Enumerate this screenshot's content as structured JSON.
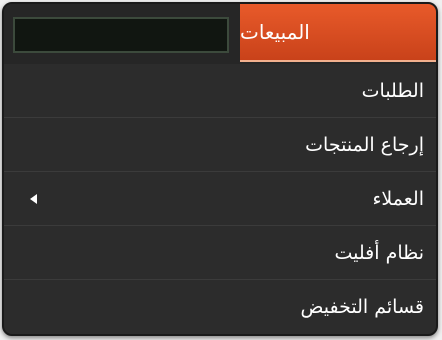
{
  "menu": {
    "active_tab": "المبيعات",
    "search_value": "",
    "items": [
      {
        "label": "الطلبات",
        "has_submenu": false
      },
      {
        "label": "إرجاع المنتجات",
        "has_submenu": false
      },
      {
        "label": "العملاء",
        "has_submenu": true
      },
      {
        "label": "نظام أفليت",
        "has_submenu": false
      },
      {
        "label": "قسائم التخفيض",
        "has_submenu": false
      }
    ]
  },
  "colors": {
    "accent": "#d94d20",
    "background": "#2c2c2c",
    "text": "#ffffff"
  }
}
